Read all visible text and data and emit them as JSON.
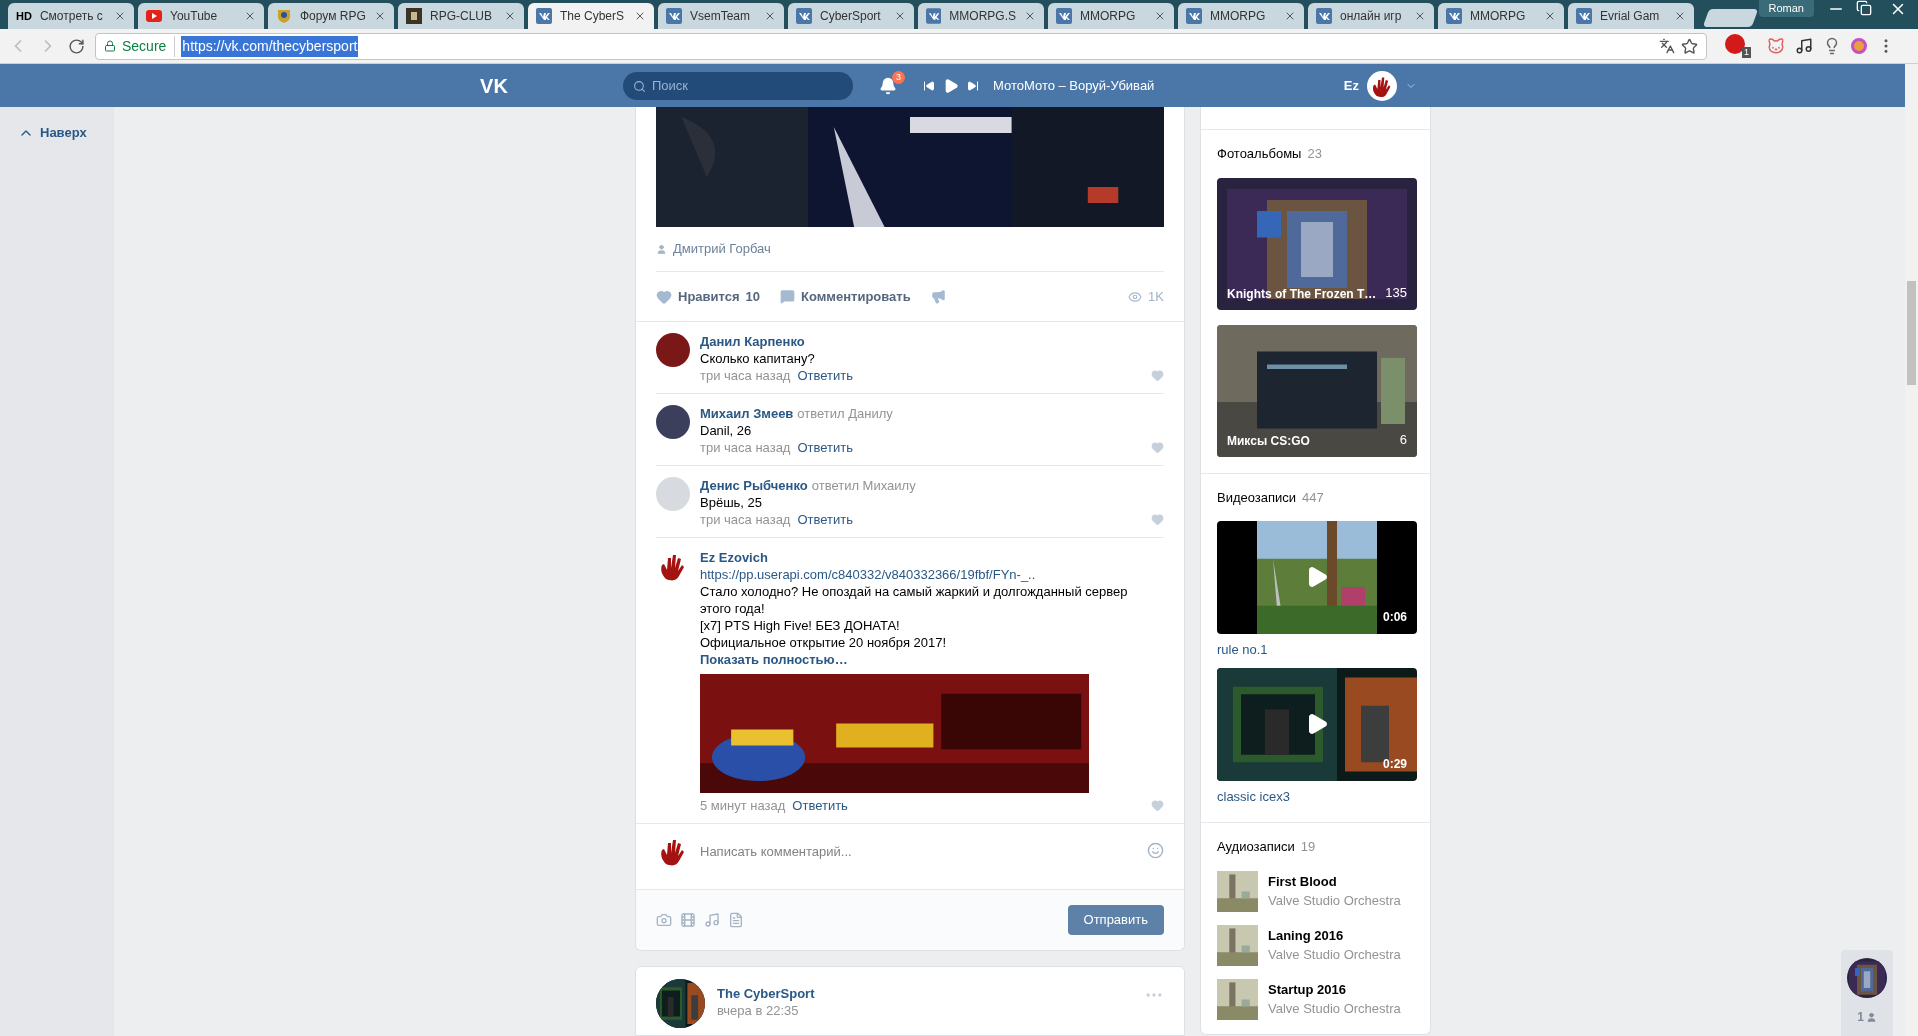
{
  "browser": {
    "tabs": [
      {
        "label": "Смотреть с",
        "icon": {
          "kind": "text",
          "text": "HD"
        },
        "selected": false
      },
      {
        "label": "YouTube",
        "icon": {
          "kind": "youtube"
        },
        "selected": false
      },
      {
        "label": "Форум RPG",
        "icon": {
          "kind": "crest"
        },
        "selected": false
      },
      {
        "label": "RPG-CLUB",
        "icon": {
          "kind": "dark"
        },
        "selected": false
      },
      {
        "label": "The CyberS",
        "icon": {
          "kind": "vk"
        },
        "selected": true
      },
      {
        "label": "VsemTeam",
        "icon": {
          "kind": "vk"
        },
        "selected": false
      },
      {
        "label": "CyberSport",
        "icon": {
          "kind": "vk"
        },
        "selected": false
      },
      {
        "label": "MMORPG.S",
        "icon": {
          "kind": "vk"
        },
        "selected": false
      },
      {
        "label": "MMORPG",
        "icon": {
          "kind": "vk"
        },
        "selected": false
      },
      {
        "label": "MMORPG",
        "icon": {
          "kind": "vk"
        },
        "selected": false
      },
      {
        "label": "онлайн игр",
        "icon": {
          "kind": "vk"
        },
        "selected": false
      },
      {
        "label": "MMORPG",
        "icon": {
          "kind": "vk"
        },
        "selected": false
      },
      {
        "label": "Evrial Gam",
        "icon": {
          "kind": "vk"
        },
        "selected": false
      }
    ],
    "profile": "Roman",
    "address": {
      "secure": "Secure",
      "url": "https://vk.com/thecybersport",
      "url_selected": true
    },
    "adblock_count": "1"
  },
  "header": {
    "logo": "VK",
    "search_placeholder": "Поиск",
    "notifications": "3",
    "track": "МотоМото – Воруй-Убивай",
    "user": "Ez"
  },
  "left_nav": {
    "back_to_top": "Наверх"
  },
  "post": {
    "photo_author": "Дмитрий Горбач",
    "like_label": "Нравится",
    "like_count": "10",
    "comment_label": "Комментировать",
    "views": "1K",
    "comments": [
      {
        "author": "Данил Карпенко",
        "lines": [
          "Сколько капитану?"
        ],
        "time": "три часа назад",
        "reply": "Ответить"
      },
      {
        "author": "Михаил Змеев",
        "reply_note": "ответил Данилу",
        "lines": [
          "Danil, 26"
        ],
        "time": "три часа назад",
        "reply": "Ответить"
      },
      {
        "author": "Денис Рыбченко",
        "reply_note": "ответил Михаилу",
        "lines": [
          "Врёшь, 25"
        ],
        "time": "три часа назад",
        "reply": "Ответить"
      },
      {
        "kind": "hand",
        "author": "Ez Ezovich",
        "link": "https://pp.userapi.com/c840332/v840332366/19fbf/FYn-_..",
        "lines": [
          "Стало холодно? Не опоздай на самый жаркий и долгожданный сервер этого года!",
          "[x7] PTS High Five! БЕЗ ДОНАТА!",
          "Официальное открытие 20 ноября 2017!"
        ],
        "more": "Показать полностью…",
        "attachment": {
          "kind": "picture"
        },
        "time": "5 минут назад",
        "reply": "Ответить"
      }
    ],
    "composer": {
      "placeholder": "Написать комментарий...",
      "send": "Отправить"
    }
  },
  "next_post": {
    "author": "The CyberSport",
    "time": "вчера в 22:35"
  },
  "sidebar": {
    "albums": {
      "title": "Фотоальбомы",
      "count": "23",
      "items": [
        {
          "title": "Knights of The Frozen T…",
          "count": "135"
        },
        {
          "title": "Миксы CS:GO",
          "count": "6"
        }
      ]
    },
    "videos": {
      "title": "Видеозаписи",
      "count": "447",
      "items": [
        {
          "title": "rule no.1",
          "duration": "0:06"
        },
        {
          "title": "classic icex3",
          "duration": "0:29"
        }
      ]
    },
    "audio": {
      "title": "Аудиозаписи",
      "count": "19",
      "items": [
        {
          "title": "First Blood",
          "artist": "Valve Studio Orchestra"
        },
        {
          "title": "Laning 2016",
          "artist": "Valve Studio Orchestra"
        },
        {
          "title": "Startup 2016",
          "artist": "Valve Studio Orchestra"
        }
      ]
    }
  },
  "chat_widget": {
    "count": "1"
  }
}
